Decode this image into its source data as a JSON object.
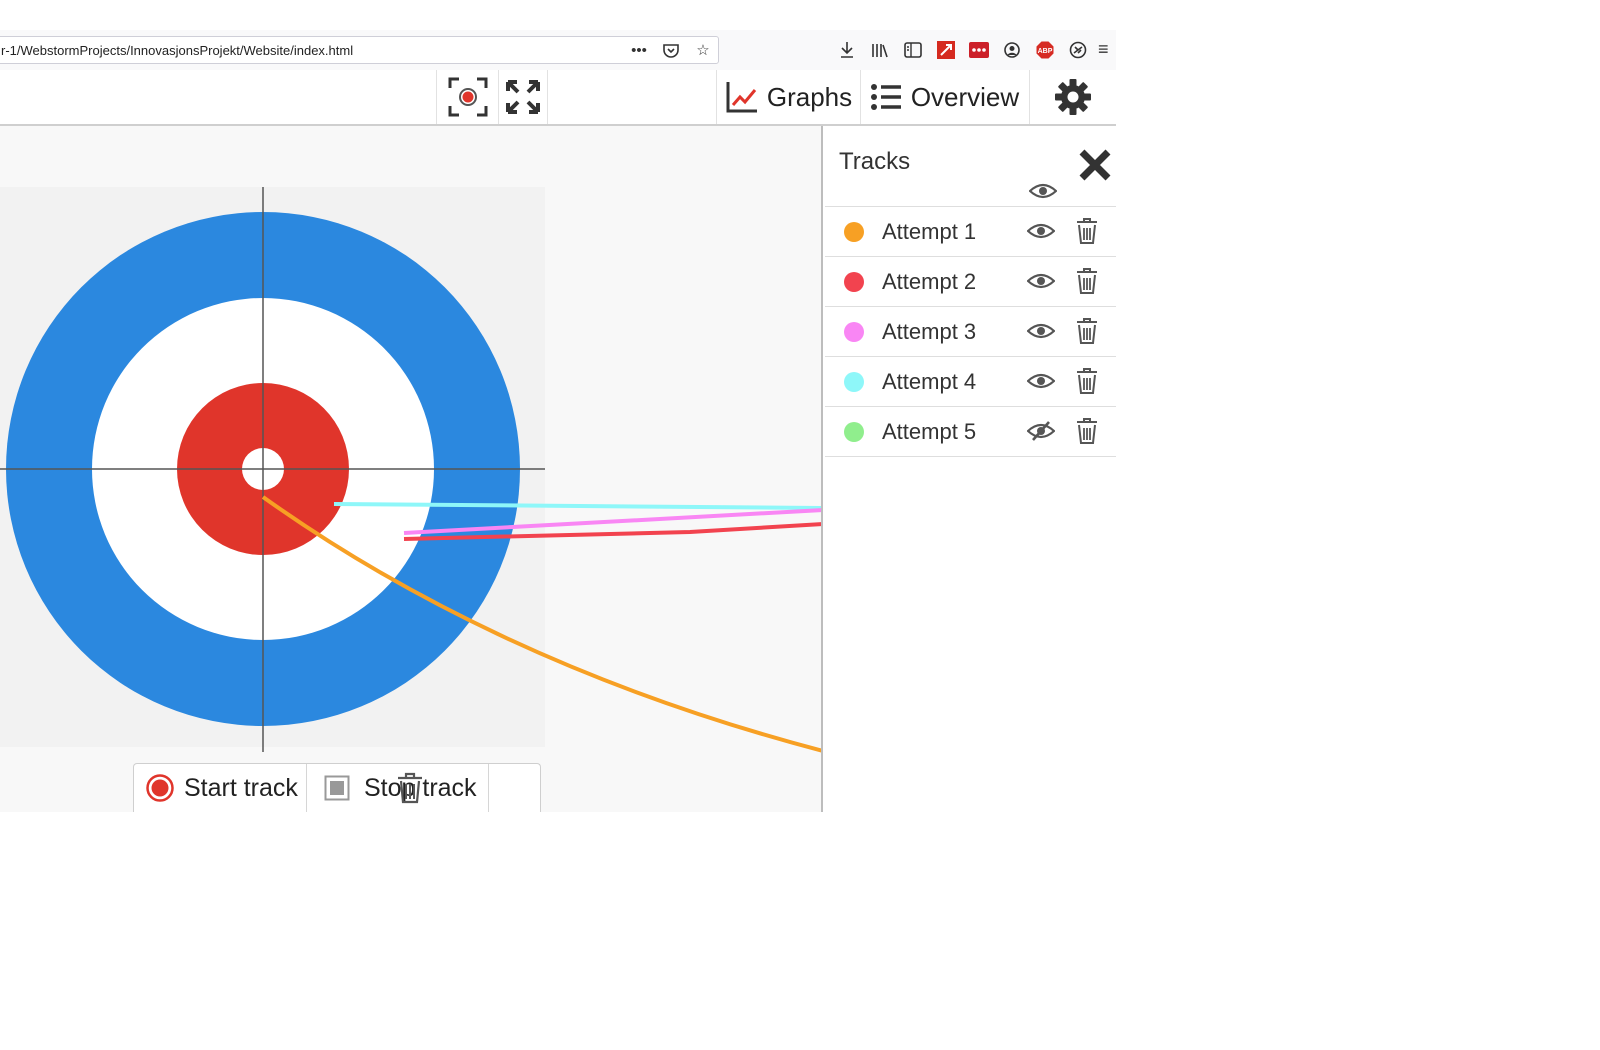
{
  "browser": {
    "url": "r-1/WebstormProjects/InnovasjonsProjekt/Website/index.html",
    "url_actions": [
      "more-actions-icon",
      "pocket-icon",
      "bookmark-star-icon"
    ],
    "toolbar_icons": [
      "download-icon",
      "library-icon",
      "sidebar-icon",
      "red-extension-icon",
      "lastpass-icon",
      "account-icon",
      "adblock-plus-icon",
      "extension-icon"
    ],
    "adblock_label": "ABP",
    "menu_icon": "hamburger-menu-icon"
  },
  "toolbar": {
    "target_icon": "record-target-icon",
    "expand_icon": "fullscreen-expand-icon",
    "graphs_label": "Graphs",
    "graphs_icon": "line-chart-icon",
    "overview_label": "Overview",
    "overview_icon": "list-icon",
    "settings_icon": "gear-icon"
  },
  "target": {
    "colors": {
      "outer": "#2b88df",
      "middle": "#ffffff",
      "inner": "#e0352b",
      "center": "#ffffff",
      "background": "#f2f2f2",
      "crosshair": "#555555"
    }
  },
  "controls": {
    "start_label": "Start track",
    "stop_label": "Stop track",
    "start_color": "#e0352b"
  },
  "panel": {
    "title": "Tracks",
    "tracks": [
      {
        "name": "Attempt 1",
        "color": "#f7a024",
        "visible": true
      },
      {
        "name": "Attempt 2",
        "color": "#f2434f",
        "visible": true
      },
      {
        "name": "Attempt 3",
        "color": "#f986f4",
        "visible": true
      },
      {
        "name": "Attempt 4",
        "color": "#8ef7f9",
        "visible": true
      },
      {
        "name": "Attempt 5",
        "color": "#90ee8d",
        "visible": false
      }
    ]
  }
}
